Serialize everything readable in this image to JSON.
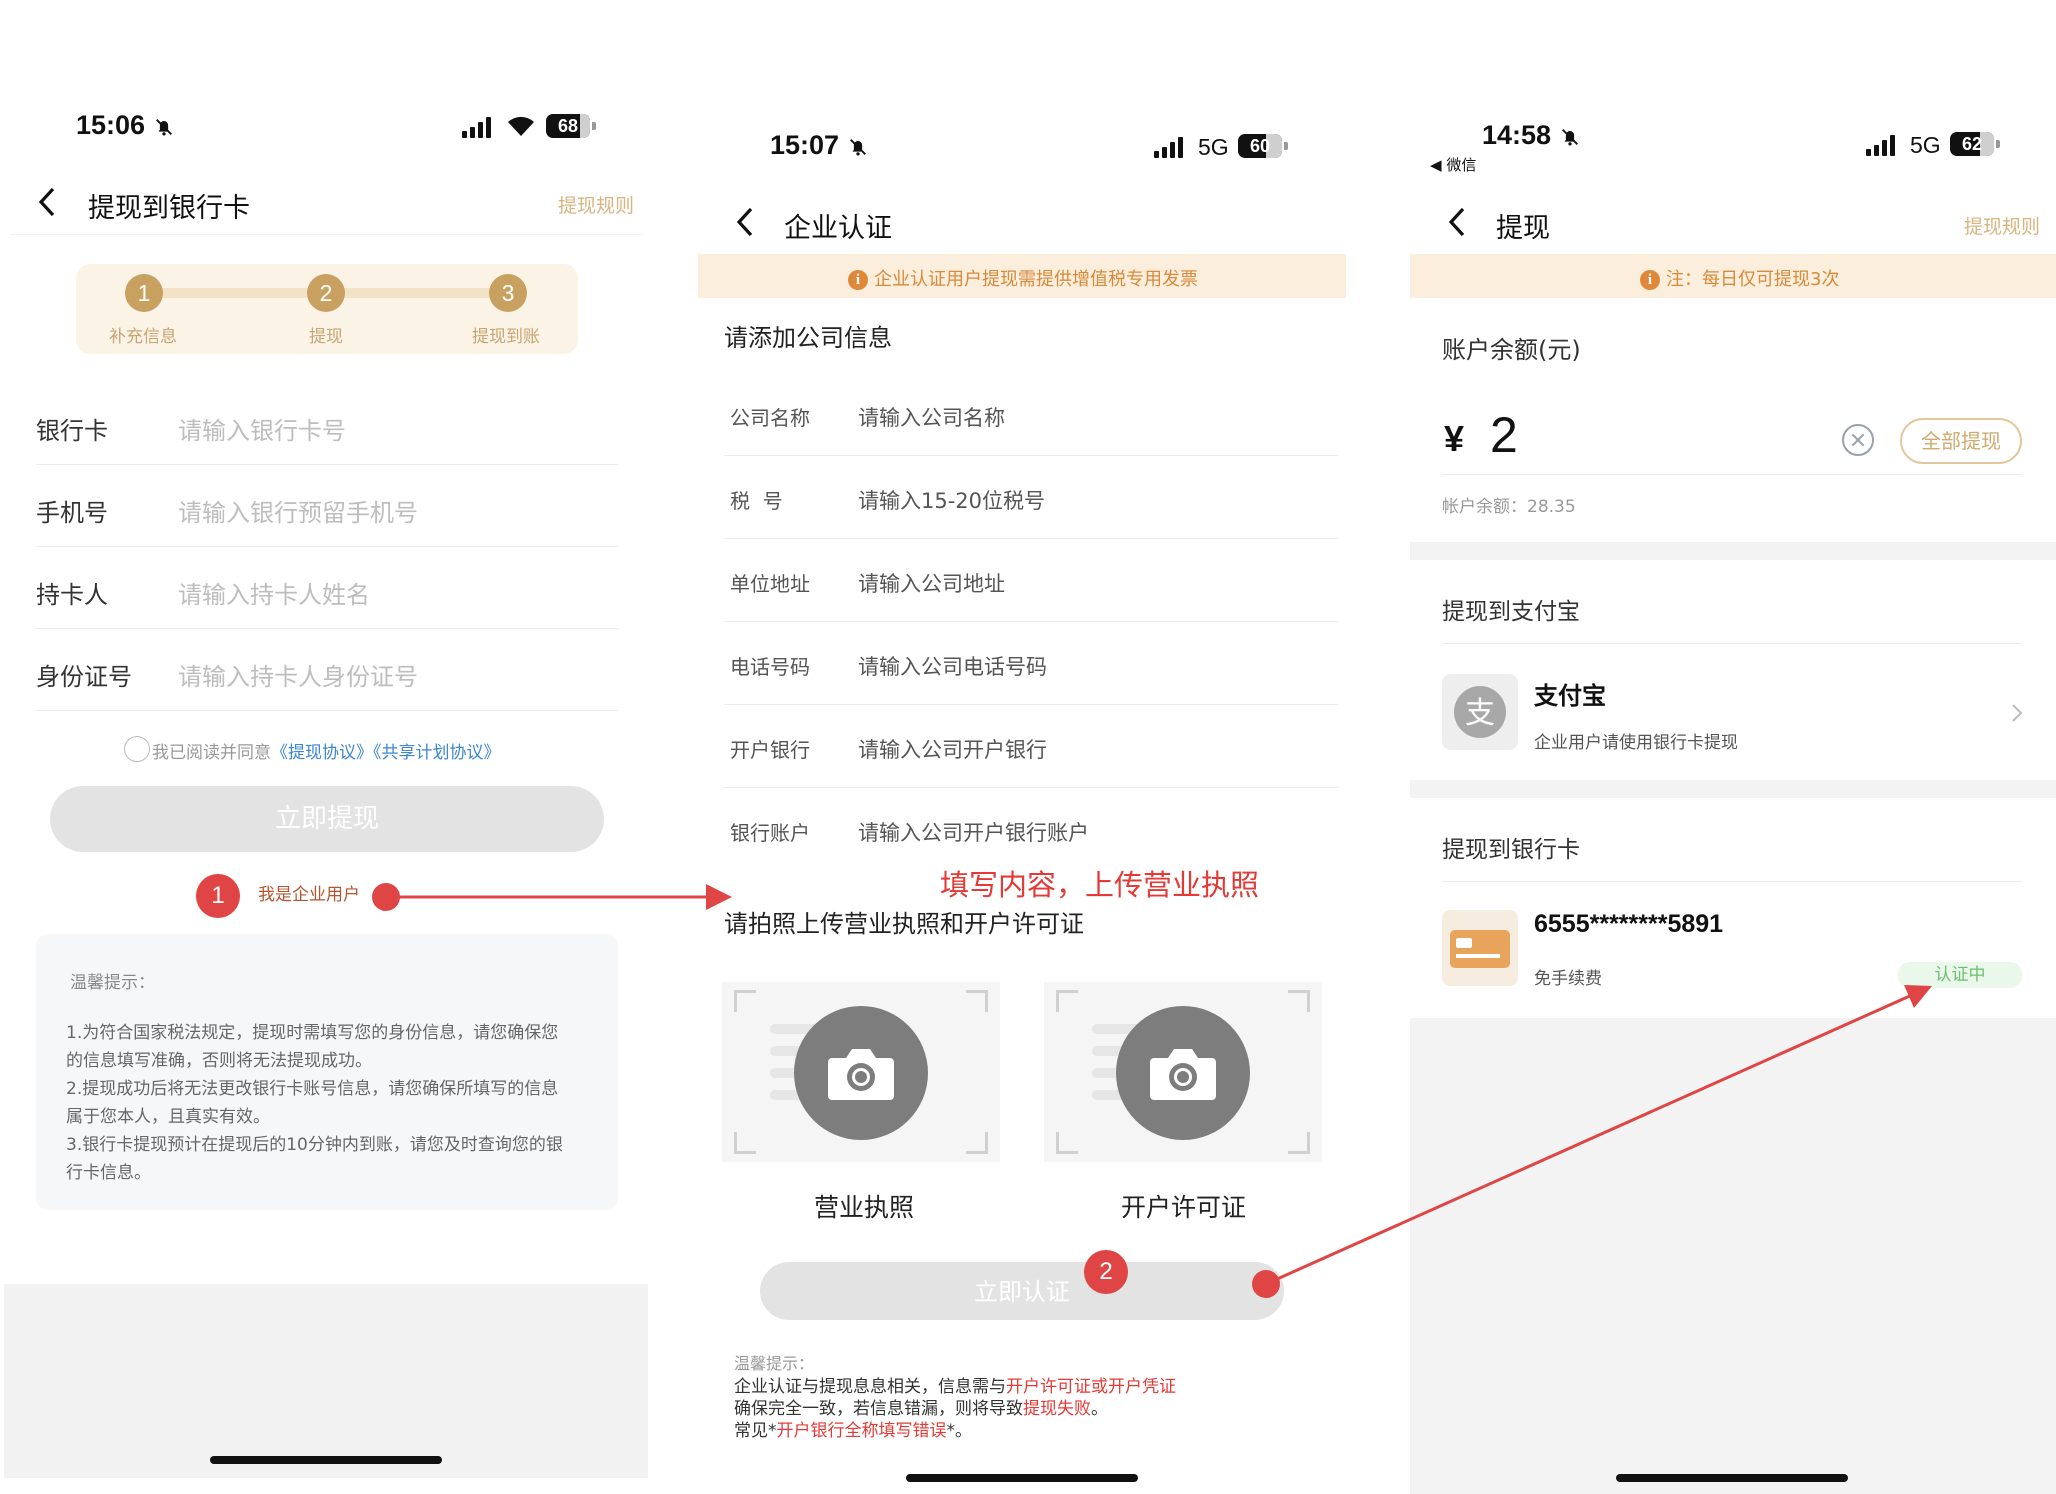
{
  "screens": [
    {
      "status": {
        "time": "15:06",
        "battery": "68"
      },
      "nav": {
        "title": "提现到银行卡",
        "link": "提现规则"
      },
      "steps": [
        {
          "num": "1",
          "label": "补充信息"
        },
        {
          "num": "2",
          "label": "提现"
        },
        {
          "num": "3",
          "label": "提现到账"
        }
      ],
      "fields": [
        {
          "label": "银行卡",
          "placeholder": "请输入银行卡号"
        },
        {
          "label": "手机号",
          "placeholder": "请输入银行预留手机号"
        },
        {
          "label": "持卡人",
          "placeholder": "请输入持卡人姓名"
        },
        {
          "label": "身份证号",
          "placeholder": "请输入持卡人身份证号"
        }
      ],
      "agree": {
        "prefix": "我已阅读并同意",
        "link1": "《提现协议》",
        "link2": "《共享计划协议》"
      },
      "submit_label": "立即提现",
      "enterprise_link": "我是企业用户",
      "badge": "1",
      "tips": {
        "title": "温馨提示：",
        "lines": [
          "1.为符合国家税法规定，提现时需填写您的身份信息，请您确保您",
          "的信息填写准确，否则将无法提现成功。",
          "2.提现成功后将无法更改银行卡账号信息，请您确保所填写的信息",
          "属于您本人，且真实有效。",
          "3.银行卡提现预计在提现后的10分钟内到账，请您及时查询您的银",
          "行卡信息。"
        ]
      }
    },
    {
      "status": {
        "time": "15:07",
        "network": "5G",
        "battery": "60"
      },
      "nav": {
        "title": "企业认证"
      },
      "notice": "企业认证用户提现需提供增值税专用发票",
      "section_title": "请添加公司信息",
      "fields": [
        {
          "label": "公司名称",
          "placeholder": "请输入公司名称"
        },
        {
          "label": "税  号",
          "placeholder": "请输入15-20位税号"
        },
        {
          "label": "单位地址",
          "placeholder": "请输入公司地址"
        },
        {
          "label": "电话号码",
          "placeholder": "请输入公司电话号码"
        },
        {
          "label": "开户银行",
          "placeholder": "请输入公司开户银行"
        },
        {
          "label": "银行账户",
          "placeholder": "请输入公司开户银行账户"
        }
      ],
      "annotation": "填写内容，上传营业执照",
      "upload_title": "请拍照上传营业执照和开户许可证",
      "uploads": [
        {
          "label": "营业执照"
        },
        {
          "label": "开户许可证"
        }
      ],
      "submit_label": "立即认证",
      "badge": "2",
      "tips": {
        "title": "温馨提示：",
        "line1_prefix": "企业认证与提现息息相关，信息需与",
        "line1_highlight": "开户许可证或开户凭证",
        "line2_prefix": "确保完全一致，若信息错漏，则将导致",
        "line2_highlight": "提现失败",
        "line2_suffix": "。",
        "line3_prefix": "常见*",
        "line3_highlight": "开户银行全称填写错误",
        "line3_suffix": "*。"
      }
    },
    {
      "status": {
        "time": "14:58",
        "back_app": "微信",
        "network": "5G",
        "battery": "62"
      },
      "nav": {
        "title": "提现",
        "link": "提现规则"
      },
      "notice": "注：每日仅可提现3次",
      "balance": {
        "label": "账户余额(元)",
        "currency": "¥",
        "amount": "2",
        "all_button": "全部提现",
        "available": "帐户余额：28.35"
      },
      "alipay": {
        "section": "提现到支付宝",
        "name": "支付宝",
        "desc": "企业用户请使用银行卡提现"
      },
      "bank": {
        "section": "提现到银行卡",
        "card": "6555********5891",
        "desc": "免手续费",
        "status": "认证中"
      }
    }
  ],
  "colors": {
    "accent": "#c8a060",
    "annotation_red": "#e53935",
    "notice_orange": "#d88a3a",
    "status_green": "#6cc06f"
  }
}
